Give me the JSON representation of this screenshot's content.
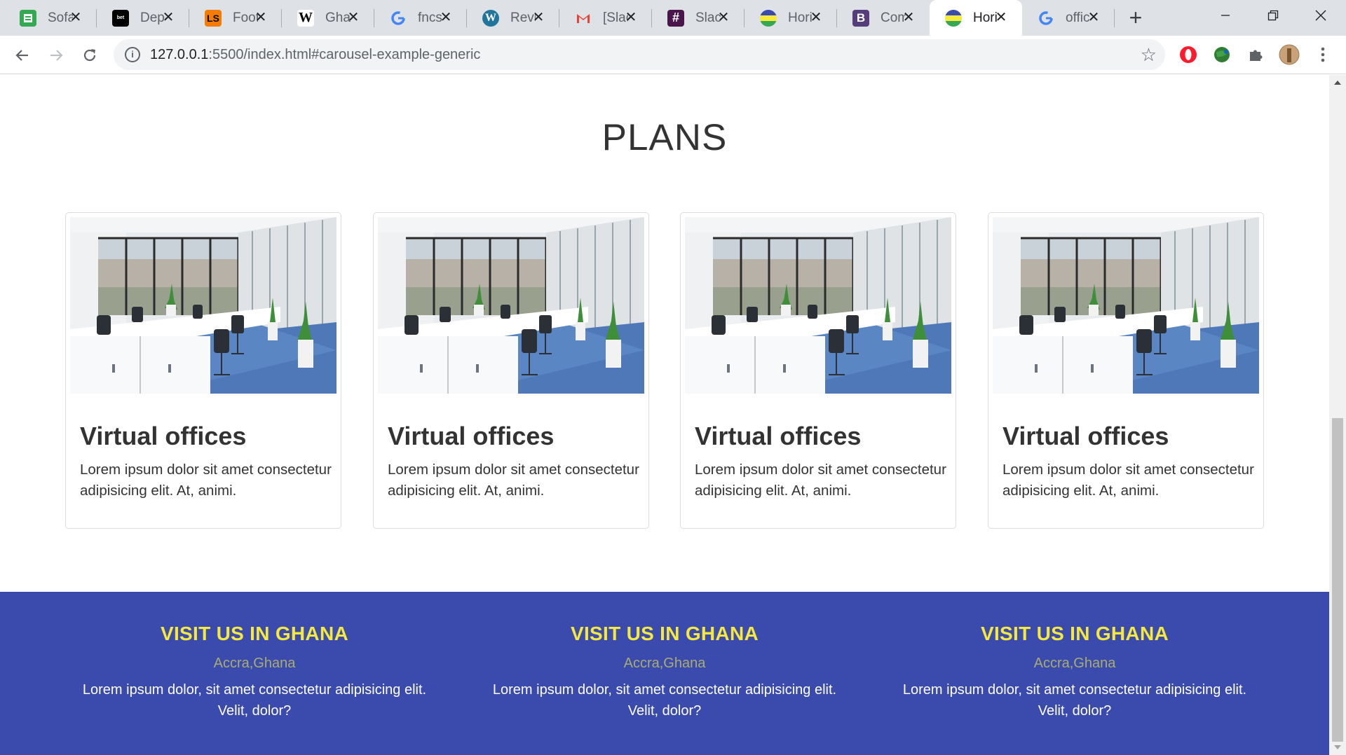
{
  "browser": {
    "tabs": [
      {
        "title": "Sofa",
        "icon": "sheets-icon",
        "color": "#34a853"
      },
      {
        "title": "Depo",
        "icon": "betway-icon",
        "color": "#000000"
      },
      {
        "title": "Foot",
        "icon": "livescore-icon",
        "color": "#f57c00"
      },
      {
        "title": "Ghana",
        "icon": "wikipedia-icon",
        "color": "#ffffff"
      },
      {
        "title": "fncs",
        "icon": "google-icon",
        "color": "#4285f4"
      },
      {
        "title": "Revu",
        "icon": "wordpress-icon",
        "color": "#21759b"
      },
      {
        "title": "[Slac",
        "icon": "gmail-icon",
        "color": "#ea4335"
      },
      {
        "title": "Slack",
        "icon": "slack-icon",
        "color": "#4a154b"
      },
      {
        "title": "Hori",
        "icon": "site-globe-icon",
        "color": "#3a4aad"
      },
      {
        "title": "Com",
        "icon": "bootstrap-icon",
        "color": "#563d7c"
      },
      {
        "title": "Hori",
        "icon": "site-globe-icon",
        "color": "#3a4aad",
        "active": true
      },
      {
        "title": "offic",
        "icon": "google-icon",
        "color": "#4285f4"
      }
    ],
    "url_host": "127.0.0.1",
    "url_rest": ":5500/index.html#carousel-example-generic"
  },
  "plans": {
    "title": "PLANS",
    "cards": [
      {
        "title": "Virtual offices",
        "text": "Lorem ipsum dolor sit amet consectetur adipisicing elit. At, animi."
      },
      {
        "title": "Virtual offices",
        "text": "Lorem ipsum dolor sit amet consectetur adipisicing elit. At, animi."
      },
      {
        "title": "Virtual offices",
        "text": "Lorem ipsum dolor sit amet consectetur adipisicing elit. At, animi."
      },
      {
        "title": "Virtual offices",
        "text": "Lorem ipsum dolor sit amet consectetur adipisicing elit. At, animi."
      }
    ]
  },
  "footer": {
    "background": "#3a4aad",
    "heading_color": "#f5e93d",
    "columns": [
      {
        "heading": "VISIT US IN GHANA",
        "city": "Accra,Ghana",
        "text": "Lorem ipsum dolor, sit amet consectetur adipisicing elit. Velit, dolor?"
      },
      {
        "heading": "VISIT US IN GHANA",
        "city": "Accra,Ghana",
        "text": "Lorem ipsum dolor, sit amet consectetur adipisicing elit. Velit, dolor?"
      },
      {
        "heading": "VISIT US IN GHANA",
        "city": "Accra,Ghana",
        "text": "Lorem ipsum dolor, sit amet consectetur adipisicing elit. Velit, dolor?"
      }
    ]
  }
}
